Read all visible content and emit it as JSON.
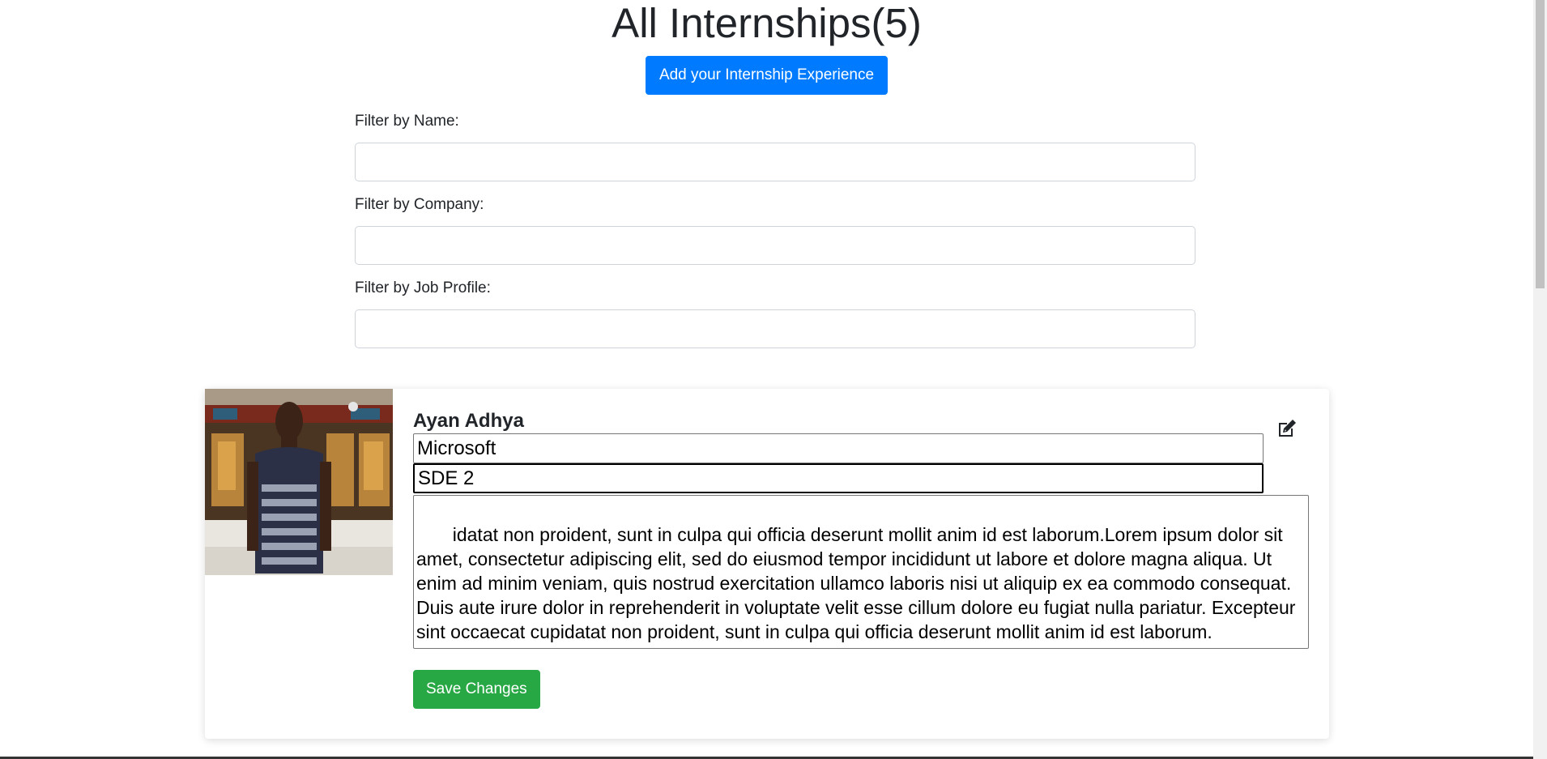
{
  "header": {
    "title": "All Internships(5)",
    "add_button_label": "Add your Internship Experience"
  },
  "filters": [
    {
      "label": "Filter by Name:",
      "value": "",
      "placeholder": ""
    },
    {
      "label": "Filter by Company:",
      "value": "",
      "placeholder": ""
    },
    {
      "label": "Filter by Job Profile:",
      "value": "",
      "placeholder": ""
    }
  ],
  "card": {
    "name": "Ayan Adhya",
    "company": "Microsoft",
    "job_profile": "SDE 2",
    "description": " idatat non proident, sunt in culpa qui officia deserunt mollit anim id est laborum.Lorem ipsum dolor sit amet, consectetur adipiscing elit, sed do eiusmod tempor incididunt ut labore et dolore magna aliqua. Ut enim ad minim veniam, quis nostrud exercitation ullamco laboris nisi ut aliquip ex ea commodo consequat. Duis aute irure dolor in reprehenderit in voluptate velit esse cillum dolore eu fugiat nulla pariatur. Excepteur sint occaecat cupidatat non proident, sunt in culpa qui officia deserunt mollit anim id est laborum.",
    "save_button_label": "Save Changes",
    "icons": {
      "edit": "edit-icon",
      "avatar": "profile-photo"
    }
  },
  "colors": {
    "primary_button": "#007bff",
    "success_button": "#28a745",
    "text": "#212529"
  }
}
